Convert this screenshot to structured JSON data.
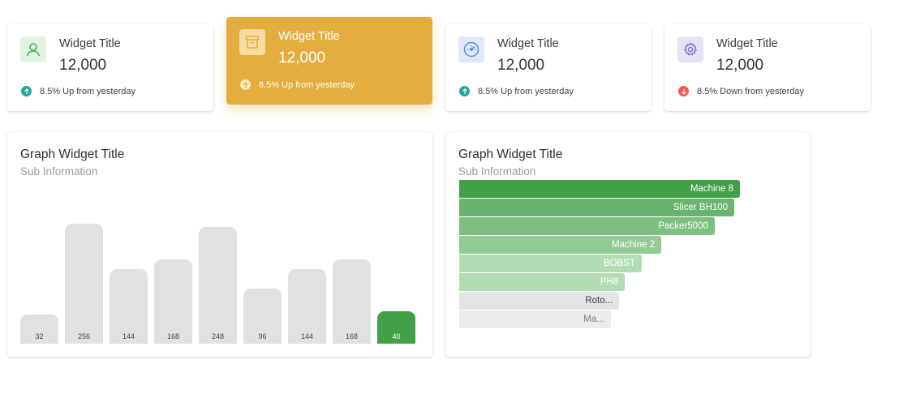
{
  "colors": {
    "accent": "#e3ae3f",
    "green": "#42a047",
    "up": "#26a69a",
    "down": "#f05b4f",
    "bar_gray": "#e1e1e3"
  },
  "cards": [
    {
      "icon": "user-icon",
      "title": "Widget Title",
      "value": "12,000",
      "trend_direction": "up",
      "trend_text": "8.5% Up from yesterday"
    },
    {
      "icon": "archive-icon",
      "title": "Widget Title",
      "value": "12,000",
      "trend_direction": "up",
      "trend_text": "8.5% Up from yesterday"
    },
    {
      "icon": "speedometer-icon",
      "title": "Widget Title",
      "value": "12,000",
      "trend_direction": "up",
      "trend_text": "8.5% Up from yesterday"
    },
    {
      "icon": "gear-icon",
      "title": "Widget Title",
      "value": "12,000",
      "trend_direction": "down",
      "trend_text": "8.5% Down from yesterday"
    }
  ],
  "graph_left": {
    "title": "Graph Widget Title",
    "subtitle": "Sub Information"
  },
  "graph_right": {
    "title": "Graph Widget Title",
    "subtitle": "Sub Information"
  },
  "chart_data": [
    {
      "type": "bar",
      "categories": [
        "",
        "",
        "",
        "",
        "",
        "",
        "",
        "",
        ""
      ],
      "values": [
        32,
        256,
        144,
        168,
        248,
        96,
        144,
        168,
        40
      ],
      "labels": [
        "32",
        "256",
        "144",
        "168",
        "248",
        "96",
        "144",
        "168",
        "40"
      ],
      "highlight_index": 8,
      "title": "Graph Widget Title",
      "subtitle": "Sub Information"
    },
    {
      "type": "bar",
      "orientation": "horizontal",
      "categories": [
        "Machine 8",
        "Slicer BH100",
        "Packer5000",
        "Machine 2",
        "BOBST",
        "PH8",
        "Roto...",
        "Ma..."
      ],
      "values": [
        100,
        98,
        91,
        72,
        65,
        59,
        57,
        54
      ],
      "title": "Graph Widget Title",
      "subtitle": "Sub Information"
    }
  ]
}
